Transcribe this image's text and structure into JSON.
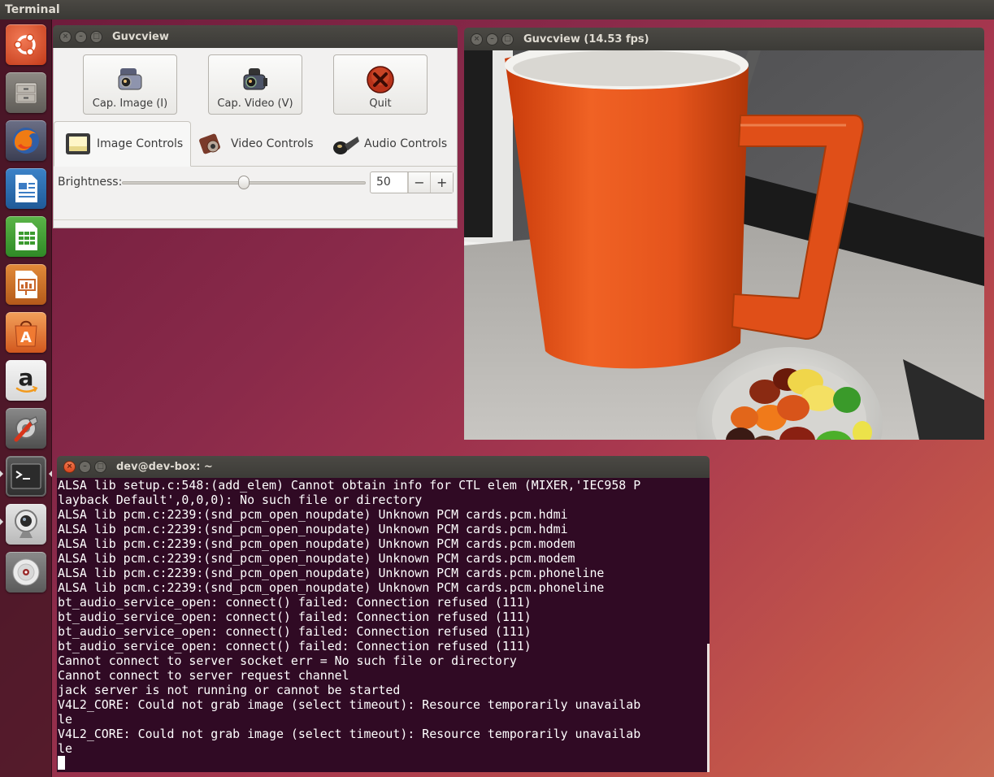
{
  "panel": {
    "title": "Terminal"
  },
  "launcher": {
    "items": [
      {
        "name": "dash-home",
        "icon": "ubuntu-logo-icon"
      },
      {
        "name": "files",
        "icon": "file-cabinet-icon"
      },
      {
        "name": "firefox",
        "icon": "firefox-icon"
      },
      {
        "name": "libreoffice-writer",
        "icon": "writer-document-icon"
      },
      {
        "name": "libreoffice-calc",
        "icon": "calc-spreadsheet-icon"
      },
      {
        "name": "libreoffice-impress",
        "icon": "impress-presentation-icon"
      },
      {
        "name": "ubuntu-software-center",
        "icon": "software-bag-icon"
      },
      {
        "name": "amazon",
        "icon": "amazon-icon"
      },
      {
        "name": "system-settings",
        "icon": "settings-tools-icon"
      },
      {
        "name": "terminal",
        "icon": "terminal-icon"
      },
      {
        "name": "guvcview",
        "icon": "webcam-icon"
      },
      {
        "name": "disc-drive",
        "icon": "disc-icon"
      }
    ],
    "amazon_glyph": "a"
  },
  "controls_window": {
    "title": "Guvcview",
    "buttons": {
      "cap_image": "Cap. Image (I)",
      "cap_video": "Cap. Video (V)",
      "quit": "Quit"
    },
    "tabs": {
      "image": "Image Controls",
      "video": "Video Controls",
      "audio": "Audio Controls"
    },
    "brightness": {
      "label": "Brightness:",
      "value": "50",
      "minus": "−",
      "plus": "+",
      "level_fraction": 0.5
    }
  },
  "preview_window": {
    "title": "Guvcview  (14.53 fps)"
  },
  "terminal_window": {
    "title": "dev@dev-box: ~",
    "lines": [
      "ALSA lib setup.c:548:(add_elem) Cannot obtain info for CTL elem (MIXER,'IEC958 P",
      "layback Default',0,0,0): No such file or directory",
      "ALSA lib pcm.c:2239:(snd_pcm_open_noupdate) Unknown PCM cards.pcm.hdmi",
      "ALSA lib pcm.c:2239:(snd_pcm_open_noupdate) Unknown PCM cards.pcm.hdmi",
      "ALSA lib pcm.c:2239:(snd_pcm_open_noupdate) Unknown PCM cards.pcm.modem",
      "ALSA lib pcm.c:2239:(snd_pcm_open_noupdate) Unknown PCM cards.pcm.modem",
      "ALSA lib pcm.c:2239:(snd_pcm_open_noupdate) Unknown PCM cards.pcm.phoneline",
      "ALSA lib pcm.c:2239:(snd_pcm_open_noupdate) Unknown PCM cards.pcm.phoneline",
      "bt_audio_service_open: connect() failed: Connection refused (111)",
      "bt_audio_service_open: connect() failed: Connection refused (111)",
      "bt_audio_service_open: connect() failed: Connection refused (111)",
      "bt_audio_service_open: connect() failed: Connection refused (111)",
      "Cannot connect to server socket err = No such file or directory",
      "Cannot connect to server request channel",
      "jack server is not running or cannot be started",
      "V4L2_CORE: Could not grab image (select timeout): Resource temporarily unavailab",
      "le",
      "V4L2_CORE: Could not grab image (select timeout): Resource temporarily unavailab",
      "le"
    ]
  },
  "colors": {
    "terminal_bg": "#300a24",
    "titlebar": "#3c3b37",
    "close_button": "#e2562a",
    "mug_orange": "#e8531c"
  }
}
